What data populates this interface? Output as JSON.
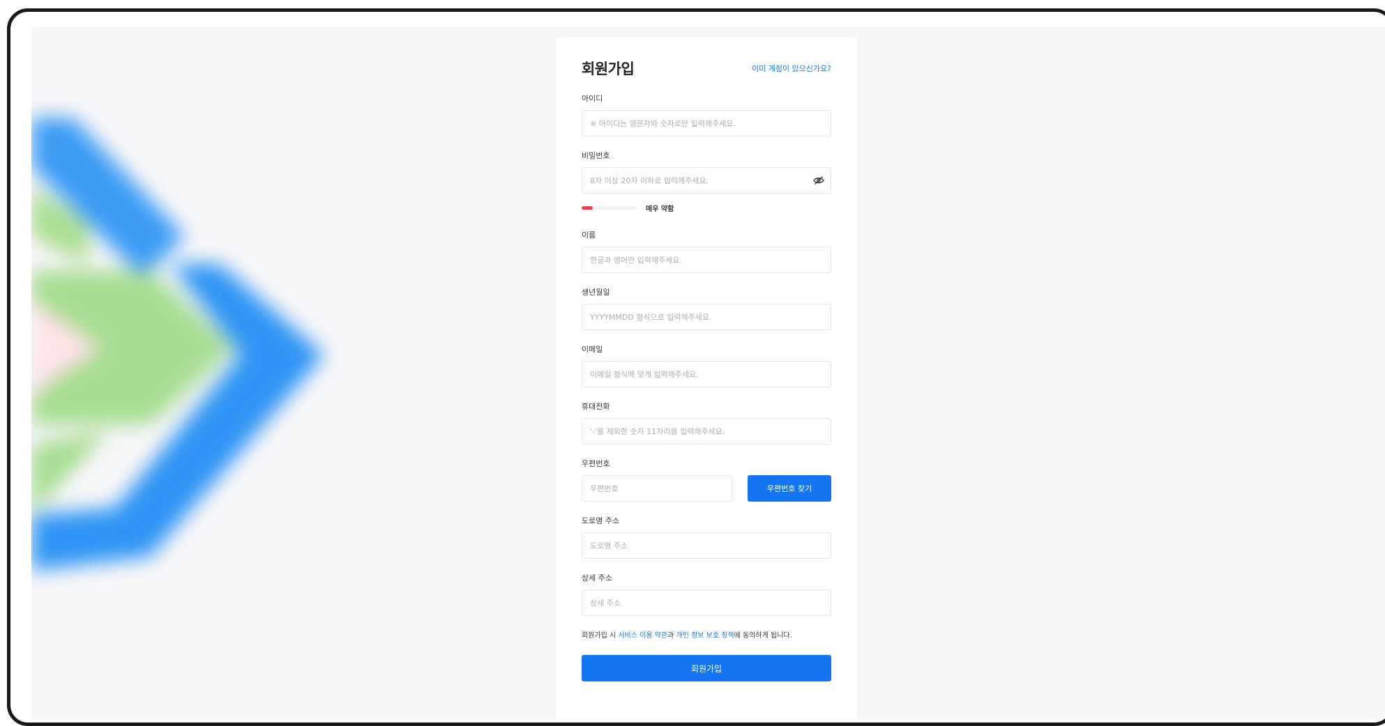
{
  "form": {
    "title": "회원가입",
    "login_link": "이미 계정이 있으신가요?",
    "fields": {
      "id": {
        "label": "아이디",
        "placeholder": "※ 아이디는 영문자와 숫자로만 입력해주세요."
      },
      "password": {
        "label": "비밀번호",
        "placeholder": "8자 이상 20자 이하로 입력해주세요.",
        "toggle_icon": "eye-off-icon"
      },
      "name": {
        "label": "이름",
        "placeholder": "한글과 영어만 입력해주세요."
      },
      "birth": {
        "label": "생년월일",
        "placeholder": "YYYYMMDD 형식으로 입력해주세요."
      },
      "email": {
        "label": "이메일",
        "placeholder": "이메일 형식에 맞게 입력해주세요."
      },
      "phone": {
        "label": "휴대전화",
        "placeholder": "'-'를 제외한 숫자 11자리를 입력해주세요."
      },
      "zip": {
        "label": "우편번호",
        "placeholder": "우편번호",
        "button": "우편번호 찾기"
      },
      "road": {
        "label": "도로명 주소",
        "placeholder": "도로명 주소"
      },
      "detail": {
        "label": "상세 주소",
        "placeholder": "상세 주소"
      }
    },
    "strength": {
      "text": "매우 약함",
      "level": 0.2,
      "color": "#e9434f"
    },
    "agree": {
      "prefix": "회원가입 시 ",
      "terms": "서비스 이용 약관",
      "middle": "과 ",
      "privacy": "개인 정보 보호 정책",
      "suffix": "에 동의하게 됩니다."
    },
    "submit": "회원가입"
  },
  "colors": {
    "accent": "#1476f2",
    "danger": "#e9434f",
    "background": "#f6f7f9"
  }
}
